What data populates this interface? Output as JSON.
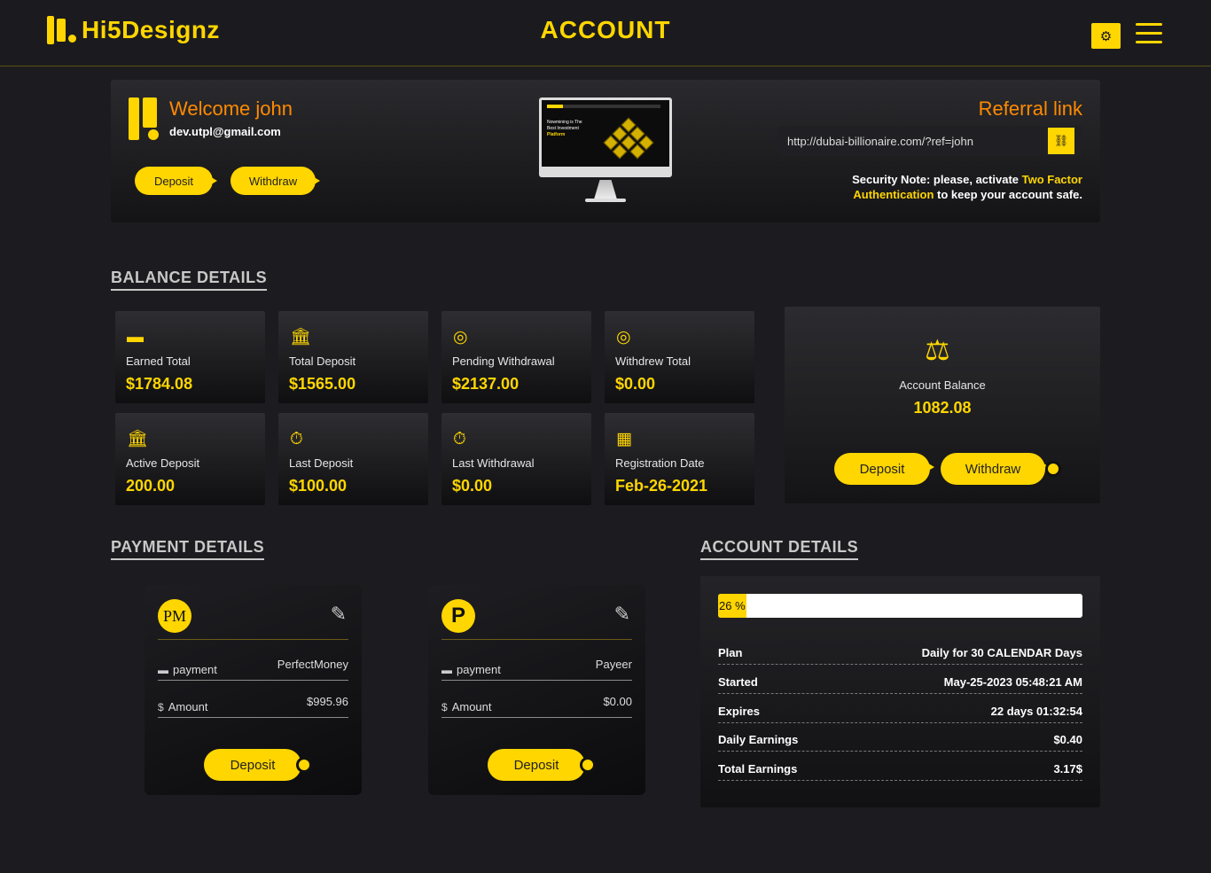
{
  "header": {
    "logo_text": "Hi5Designz",
    "title": "ACCOUNT",
    "settings_icon": "gear-icon",
    "menu_icon": "hamburger-icon"
  },
  "welcome": {
    "greeting": "Welcome john",
    "email": "dev.utpl@gmail.com",
    "deposit_label": "Deposit",
    "withdraw_label": "Withdraw"
  },
  "preview": {
    "line1": "Nowmining is The",
    "line2": "Best Investment",
    "line3": "Platform"
  },
  "referral": {
    "title": "Referral link",
    "link": "http://dubai-billionaire.com/?ref=john",
    "copy_icon": "link-icon",
    "security_prefix": "Security Note: please, activate ",
    "security_highlight": "Two Factor Authentication",
    "security_suffix": " to keep your account safe."
  },
  "balance": {
    "heading": "BALANCE DETAILS",
    "stats": [
      {
        "label": "Earned Total",
        "value": "$1784.08",
        "icon": "wallet-icon"
      },
      {
        "label": "Total Deposit",
        "value": "$1565.00",
        "icon": "bank-icon"
      },
      {
        "label": "Pending Withdrawal",
        "value": "$2137.00",
        "icon": "coins-icon"
      },
      {
        "label": "Withdrew Total",
        "value": "$0.00",
        "icon": "coins-icon"
      },
      {
        "label": "Active Deposit",
        "value": "200.00",
        "icon": "bank-icon"
      },
      {
        "label": "Last Deposit",
        "value": "$100.00",
        "icon": "stopwatch-icon"
      },
      {
        "label": "Last Withdrawal",
        "value": "$0.00",
        "icon": "stopwatch-icon"
      },
      {
        "label": "Registration Date",
        "value": "Feb-26-2021",
        "icon": "calendar-icon"
      }
    ],
    "account_balance_label": "Account Balance",
    "account_balance_value": "1082.08",
    "deposit_label": "Deposit",
    "withdraw_label": "Withdraw"
  },
  "payment": {
    "heading": "PAYMENT DETAILS",
    "cards": [
      {
        "logo": "PM",
        "method_label": "payment",
        "method": "PerfectMoney",
        "amount_label": "Amount",
        "amount": "$995.96",
        "deposit_label": "Deposit"
      },
      {
        "logo": "P",
        "method_label": "payment",
        "method": "Payeer",
        "amount_label": "Amount",
        "amount": "$0.00",
        "deposit_label": "Deposit"
      }
    ]
  },
  "account": {
    "heading": "ACCOUNT DETAILS",
    "progress": 26,
    "progress_label": "26 %",
    "rows": [
      {
        "key": "Plan",
        "value": "Daily for 30 CALENDAR Days"
      },
      {
        "key": "Started",
        "value": "May-25-2023 05:48:21 AM"
      },
      {
        "key": "Expires",
        "value": "22 days 01:32:54"
      },
      {
        "key": "Daily Earnings",
        "value": "$0.40"
      },
      {
        "key": "Total Earnings",
        "value": "3.17$"
      }
    ]
  },
  "colors": {
    "accent": "#ffd600",
    "orange": "#ff8a00",
    "background": "#1c1c20"
  }
}
